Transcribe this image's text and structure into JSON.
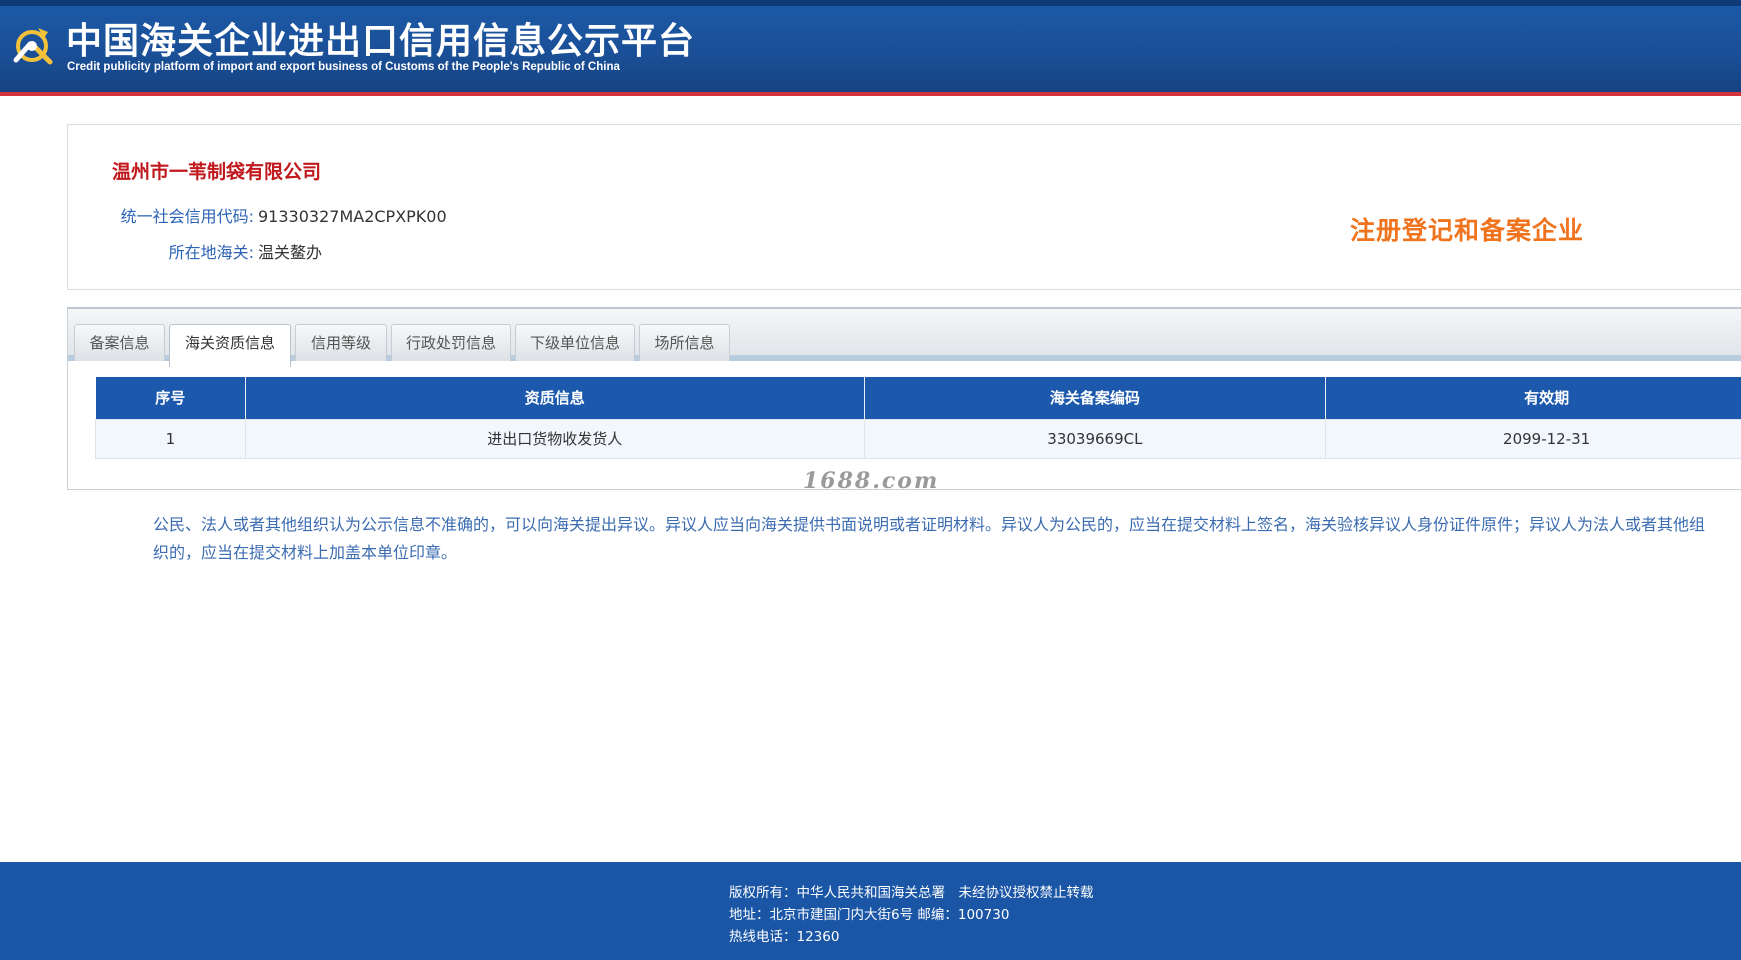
{
  "header": {
    "title": "中国海关企业进出口信用信息公示平台",
    "subtitle": "Credit publicity platform of import and export business of Customs of the People's Republic of China",
    "logo_icon": "customs-emblem-icon"
  },
  "company": {
    "name": "温州市一苇制袋有限公司",
    "credit_code_label": "统一社会信用代码:",
    "credit_code": "91330327MA2CPXPK00",
    "customs_label": "所在地海关:",
    "customs": "温关鳌办",
    "badge": "注册登记和备案企业"
  },
  "tabs": [
    {
      "label": "备案信息",
      "active": false
    },
    {
      "label": "海关资质信息",
      "active": true
    },
    {
      "label": "信用等级",
      "active": false
    },
    {
      "label": "行政处罚信息",
      "active": false
    },
    {
      "label": "下级单位信息",
      "active": false
    },
    {
      "label": "场所信息",
      "active": false
    }
  ],
  "table": {
    "headers": [
      "序号",
      "资质信息",
      "海关备案编码",
      "有效期"
    ],
    "rows": [
      [
        "1",
        "进出口货物收发货人",
        "33039669CL",
        "2099-12-31"
      ]
    ]
  },
  "watermark": "1688.com",
  "notice": "公民、法人或者其他组织认为公示信息不准确的，可以向海关提出异议。异议人应当向海关提供书面说明或者证明材料。异议人为公民的，应当在提交材料上签名，海关验核异议人身份证件原件；异议人为法人或者其他组织的，应当在提交材料上加盖本单位印章。",
  "footer": {
    "copyright": "版权所有：中华人民共和国海关总署　未经协议授权禁止转载",
    "address": "地址：北京市建国门内大街6号 邮编：100730",
    "hotline": "热线电话：12360"
  },
  "colors": {
    "header_blue": "#1a4f96",
    "header_red_line": "#d2343a",
    "company_name_red": "#c0181d",
    "label_blue": "#2c63b5",
    "badge_orange": "#f0731e",
    "table_header_blue": "#1c59ad",
    "footer_blue": "#1b56a6"
  }
}
